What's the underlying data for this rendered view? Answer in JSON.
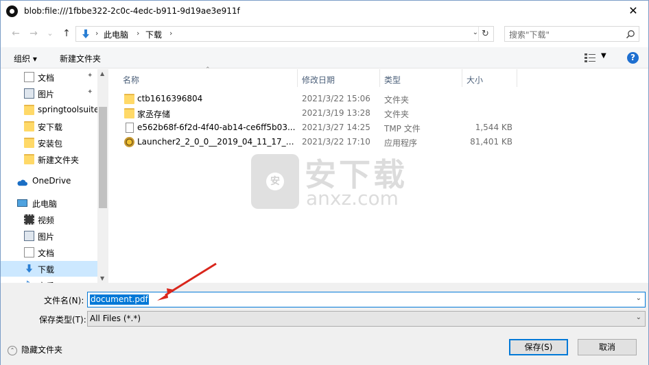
{
  "window": {
    "title": "blob:file:///1fbbe322-2c0c-4edc-b911-9d19ae3e911f",
    "close_glyph": "✕"
  },
  "address": {
    "back_glyph": "←",
    "forward_glyph": "→",
    "recent_glyph": "⌄",
    "up_glyph": "↑",
    "breadcrumbs": [
      "此电脑",
      "下载"
    ],
    "separator": "›",
    "dropdown_glyph": "⌄",
    "refresh_glyph": "↻"
  },
  "search": {
    "placeholder": "搜索\"下载\"",
    "icon": "search-icon"
  },
  "toolbar": {
    "organize": "组织 ▾",
    "new_folder": "新建文件夹",
    "help": "?"
  },
  "nav": {
    "items": [
      {
        "label": "文档",
        "icon": "document-icon",
        "pinned": true
      },
      {
        "label": "图片",
        "icon": "pictures-icon",
        "pinned": true
      },
      {
        "label": "springtoolsuite",
        "icon": "folder-icon"
      },
      {
        "label": "安下载",
        "icon": "folder-icon"
      },
      {
        "label": "安装包",
        "icon": "folder-icon"
      },
      {
        "label": "新建文件夹",
        "icon": "folder-icon"
      },
      {
        "label": "OneDrive",
        "icon": "cloud-icon"
      },
      {
        "label": "此电脑",
        "icon": "computer-icon"
      },
      {
        "label": "视频",
        "icon": "video-icon"
      },
      {
        "label": "图片",
        "icon": "pictures-icon"
      },
      {
        "label": "文档",
        "icon": "document-icon"
      },
      {
        "label": "下载",
        "icon": "download-icon",
        "selected": true
      },
      {
        "label": "音乐",
        "icon": "music-icon"
      }
    ],
    "pin_glyph": "📌"
  },
  "columns": {
    "name": "名称",
    "modified": "修改日期",
    "type": "类型",
    "size": "大小"
  },
  "files": [
    {
      "name": "ctb1616396804",
      "modified": "2021/3/22 15:06",
      "type": "文件夹",
      "size": "",
      "icon": "folder-icon"
    },
    {
      "name": "家丞存储",
      "modified": "2021/3/19 13:28",
      "type": "文件夹",
      "size": "",
      "icon": "folder-icon"
    },
    {
      "name": "e562b68f-6f2d-4f40-ab14-ce6ff5b03...",
      "modified": "2021/3/27 14:25",
      "type": "TMP 文件",
      "size": "1,544 KB",
      "icon": "file-icon"
    },
    {
      "name": "Launcher2_2_0_0__2019_04_11_17_10_...",
      "modified": "2021/3/22 17:10",
      "type": "应用程序",
      "size": "81,401 KB",
      "icon": "launcher-icon"
    }
  ],
  "watermark": {
    "text": "安下载",
    "domain": "anxz.com"
  },
  "form": {
    "filename_label": "文件名(N):",
    "filename_value": "document.pdf",
    "filetype_label": "保存类型(T):",
    "filetype_value": "All Files (*.*)",
    "dropdown_glyph": "⌄"
  },
  "footer": {
    "hide_folders": "隐藏文件夹",
    "save": "保存(S)",
    "cancel": "取消",
    "toggle_glyph": "⌃"
  },
  "colors": {
    "accent": "#0078d7",
    "selected_nav": "#cce8ff",
    "arrow": "#d9261c"
  }
}
